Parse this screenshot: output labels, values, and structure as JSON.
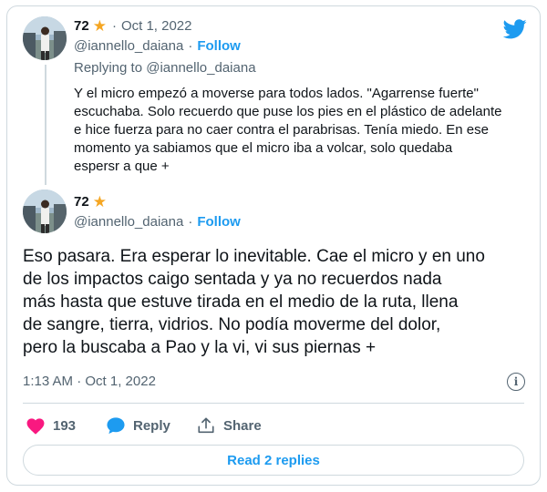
{
  "colors": {
    "accent": "#1d9bf0",
    "muted": "#536471",
    "text": "#0f1419",
    "like": "#f91880",
    "star": "#f5a623",
    "border": "#cfd9de"
  },
  "icons": {
    "logo": "twitter-bird-icon",
    "star": "star-icon",
    "info": "info-icon",
    "like": "heart-icon",
    "reply": "speech-bubble-icon",
    "share": "share-upload-icon"
  },
  "reply_tweet": {
    "name": "72",
    "separator": "·",
    "date": "Oct 1, 2022",
    "handle": "@iannello_daiana",
    "dot": "·",
    "follow_label": "Follow",
    "replying_to": "Replying to @iannello_daiana",
    "lines": [
      "Y el micro empezó a moverse para todos lados. \"Agarrense fuerte\"",
      "escuchaba. Solo recuerdo que puse los pies en el plástico de adelante",
      "e hice fuerza para no caer contra el parabrisas. Tenía miedo. En ese",
      "momento ya sabiamos que el micro iba a volcar, solo quedaba",
      "espersr a que +"
    ]
  },
  "main_tweet": {
    "name": "72",
    "handle": "@iannello_daiana",
    "dot": "·",
    "follow_label": "Follow",
    "lines": [
      "Eso pasara. Era esperar lo inevitable. Cae el micro y en uno",
      "de los impactos caigo sentada y ya no recuerdos nada",
      "más hasta que estuve tirada en el medio de la ruta, llena",
      "de sangre, tierra, vidrios. No podía moverme del dolor,",
      "pero la buscaba a Pao y la vi, vi sus piernas +"
    ],
    "timestamp": "1:13 AM · Oct 1, 2022"
  },
  "actions": {
    "like_count": "193",
    "reply_label": "Reply",
    "share_label": "Share"
  },
  "read_replies_label": "Read 2 replies"
}
